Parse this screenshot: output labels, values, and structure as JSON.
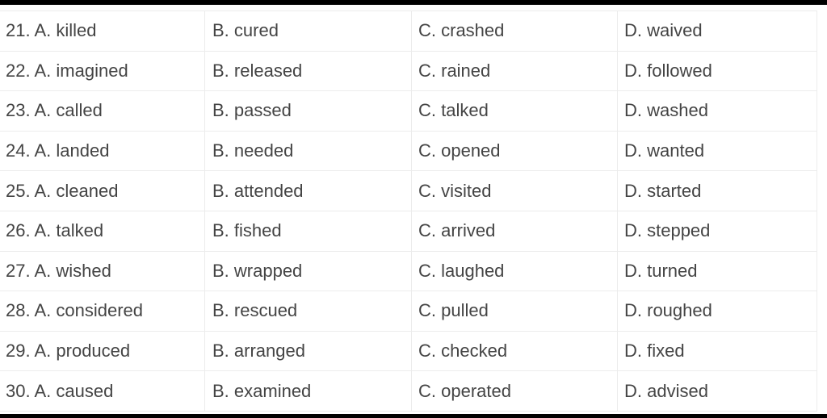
{
  "rows": [
    {
      "num": "21.",
      "a": "A. killed",
      "b": "B. cured",
      "c": "C. crashed",
      "d": "D. waived"
    },
    {
      "num": "22.",
      "a": "A. imagined",
      "b": "B. released",
      "c": "C. rained",
      "d": "D. followed"
    },
    {
      "num": "23.",
      "a": "A. called",
      "b": "B. passed",
      "c": "C. talked",
      "d": "D. washed"
    },
    {
      "num": "24.",
      "a": "A. landed",
      "b": "B. needed",
      "c": "C. opened",
      "d": "D. wanted"
    },
    {
      "num": "25.",
      "a": "A. cleaned",
      "b": "B. attended",
      "c": "C. visited",
      "d": "D. started"
    },
    {
      "num": "26.",
      "a": "A. talked",
      "b": "B. fished",
      "c": "C. arrived",
      "d": "D. stepped"
    },
    {
      "num": "27.",
      "a": "A. wished",
      "b": "B. wrapped",
      "c": "C. laughed",
      "d": "D. turned"
    },
    {
      "num": "28.",
      "a": "A. considered",
      "b": "B. rescued",
      "c": "C. pulled",
      "d": "D. roughed"
    },
    {
      "num": "29.",
      "a": "A. produced",
      "b": "B. arranged",
      "c": "C. checked",
      "d": "D. fixed"
    },
    {
      "num": "30.",
      "a": "A. caused",
      "b": "B. examined",
      "c": "C. operated",
      "d": "D. advised"
    }
  ]
}
